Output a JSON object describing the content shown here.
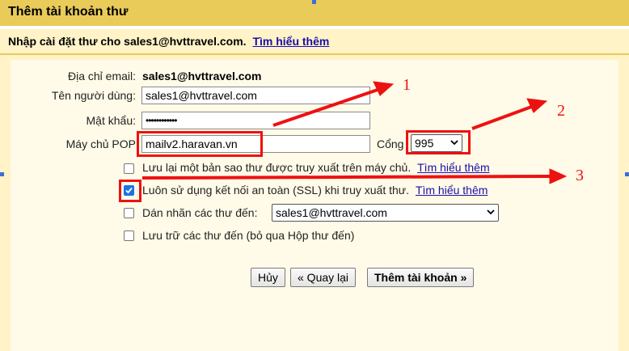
{
  "dialog": {
    "title": "Thêm tài khoản thư",
    "subheader": "Nhập cài đặt thư cho sales1@hvttravel.com.",
    "learn_more": "Tìm hiểu thêm"
  },
  "form": {
    "email_label": "Địa chỉ email:",
    "email_value": "sales1@hvttravel.com",
    "username_label": "Tên người dùng:",
    "username_value": "sales1@hvttravel.com",
    "password_label": "Mật khẩu:",
    "password_value": "••••••••••••",
    "server_label": "Máy chủ POP",
    "server_value": "mailv2.haravan.vn",
    "port_label": "Cổng",
    "port_value": "995"
  },
  "options": {
    "keep_copy": "Lưu lại một bản sao thư được truy xuất trên máy chủ.",
    "keep_copy_link": "Tìm hiểu thêm",
    "ssl": "Luôn sử dụng kết nối an toàn (SSL) khi truy xuất thư.",
    "ssl_link": "Tìm hiểu thêm",
    "label_incoming": "Dán nhãn các thư đến:",
    "label_value": "sales1@hvttravel.com",
    "archive": "Lưu trữ các thư đến (bỏ qua Hộp thư đến)"
  },
  "buttons": {
    "cancel": "Hủy",
    "back": "« Quay lại",
    "add": "Thêm tài khoản »"
  },
  "annotations": {
    "one": "1",
    "two": "2",
    "three": "3",
    "color": "#ee1111"
  }
}
